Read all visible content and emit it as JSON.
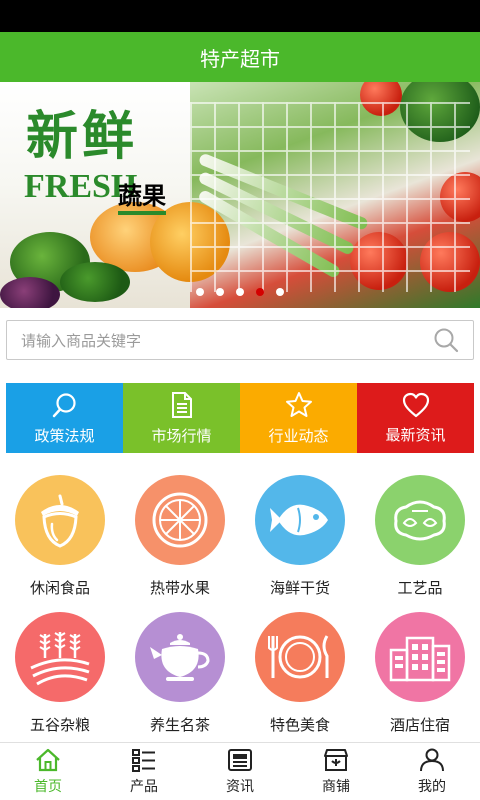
{
  "header": {
    "title": "特产超市"
  },
  "banner": {
    "title_cn": "新鲜",
    "title_en": "FRESH",
    "title_sub": "蔬果",
    "slide_count": 5,
    "active_slide": 4
  },
  "search": {
    "placeholder": "请输入商品关键字"
  },
  "quick_links": [
    {
      "label": "政策法规",
      "icon": "search-icon",
      "color": "#1aa0e6"
    },
    {
      "label": "市场行情",
      "icon": "document-icon",
      "color": "#7ac12a"
    },
    {
      "label": "行业动态",
      "icon": "star-icon",
      "color": "#fbab00"
    },
    {
      "label": "最新资讯",
      "icon": "heart-icon",
      "color": "#dd1b1b"
    }
  ],
  "categories": [
    {
      "label": "休闲食品",
      "icon": "acorn-icon",
      "color": "#f9c25b"
    },
    {
      "label": "热带水果",
      "icon": "orange-slice-icon",
      "color": "#f6916a"
    },
    {
      "label": "海鲜干货",
      "icon": "fish-icon",
      "color": "#53b7ea"
    },
    {
      "label": "工艺品",
      "icon": "ornament-icon",
      "color": "#8bd26d"
    },
    {
      "label": "五谷杂粮",
      "icon": "grain-icon",
      "color": "#f56a6a"
    },
    {
      "label": "养生名茶",
      "icon": "teapot-icon",
      "color": "#b68fd3"
    },
    {
      "label": "特色美食",
      "icon": "plate-icon",
      "color": "#f57c5c"
    },
    {
      "label": "酒店住宿",
      "icon": "building-icon",
      "color": "#f075a4"
    }
  ],
  "bottom_nav": [
    {
      "label": "首页",
      "icon": "home-icon",
      "active": true
    },
    {
      "label": "产品",
      "icon": "list-icon",
      "active": false
    },
    {
      "label": "资讯",
      "icon": "news-icon",
      "active": false
    },
    {
      "label": "商铺",
      "icon": "shop-icon",
      "active": false
    },
    {
      "label": "我的",
      "icon": "user-icon",
      "active": false
    }
  ],
  "colors": {
    "brand": "#4bb82b",
    "active_dot": "#d40000"
  }
}
